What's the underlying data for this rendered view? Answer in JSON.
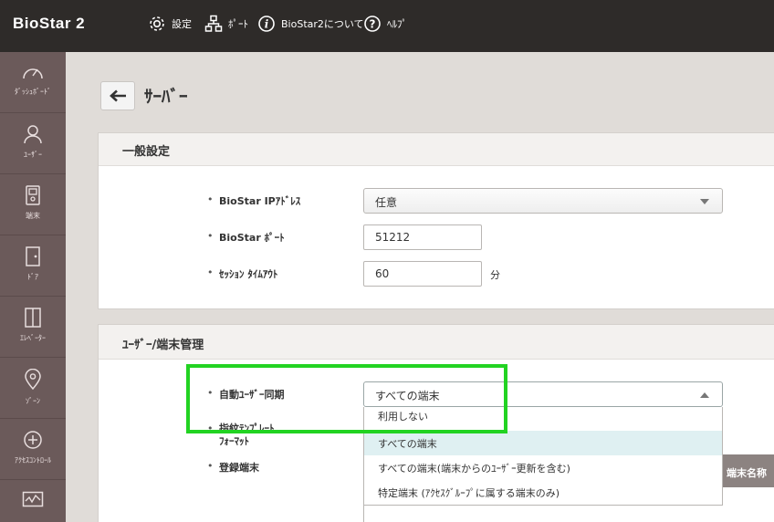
{
  "app": {
    "title": "BioStar 2"
  },
  "topnav": [
    {
      "label": "設定",
      "icon": "gear-icon"
    },
    {
      "label": "ﾎﾟｰﾄ",
      "icon": "network-icon"
    },
    {
      "label": "BioStar2について",
      "icon": "info-icon"
    },
    {
      "label": "ﾍﾙﾌﾟ",
      "icon": "help-icon"
    }
  ],
  "sidebar": {
    "items": [
      {
        "label": "ﾀﾞｯｼｭﾎﾞｰﾄﾞ",
        "icon": "dashboard-icon"
      },
      {
        "label": "ﾕｰｻﾞｰ",
        "icon": "user-icon"
      },
      {
        "label": "端末",
        "icon": "device-icon"
      },
      {
        "label": "ﾄﾞｱ",
        "icon": "door-icon"
      },
      {
        "label": "ｴﾚﾍﾞｰﾀｰ",
        "icon": "elevator-icon"
      },
      {
        "label": "ｿﾞｰﾝ",
        "icon": "zone-icon"
      },
      {
        "label": "ｱｸｾｽｺﾝﾄﾛｰﾙ",
        "icon": "access-control-icon"
      },
      {
        "label": "",
        "icon": "monitoring-icon"
      }
    ]
  },
  "page": {
    "title": "ｻｰﾊﾞｰ"
  },
  "general": {
    "heading": "一般設定",
    "ip_label": "BioStar IPｱﾄﾞﾚｽ",
    "ip_value": "任意",
    "port_label": "BioStar ﾎﾟｰﾄ",
    "port_value": "51212",
    "timeout_label": "ｾｯｼｮﾝ ﾀｲﾑｱｳﾄ",
    "timeout_value": "60",
    "timeout_unit": "分"
  },
  "user_device": {
    "heading": "ﾕｰｻﾞｰ/端末管理",
    "auto_sync_label": "自動ﾕｰｻﾞｰ同期",
    "auto_sync_value": "すべての端末",
    "fingerprint_label_1": "指紋ﾃﾝﾌﾟﾚｰﾄ",
    "fingerprint_label_2": "ﾌｫｰﾏｯﾄ",
    "registered_label": "登録端末",
    "name_header": "端末名称",
    "options": [
      "利用しない",
      "すべての端末",
      "すべての端末(端末からのﾕｰｻﾞｰ更新を含む)",
      "特定端末 (ｱｸｾｽｸﾞﾙｰﾌﾟに属する端末のみ)"
    ],
    "selected_index": 1
  },
  "colors": {
    "topbar": "#2e2b29",
    "sidebar": "#6b5a5a",
    "highlight": "#22d322",
    "selected_option": "#dff0f2"
  }
}
